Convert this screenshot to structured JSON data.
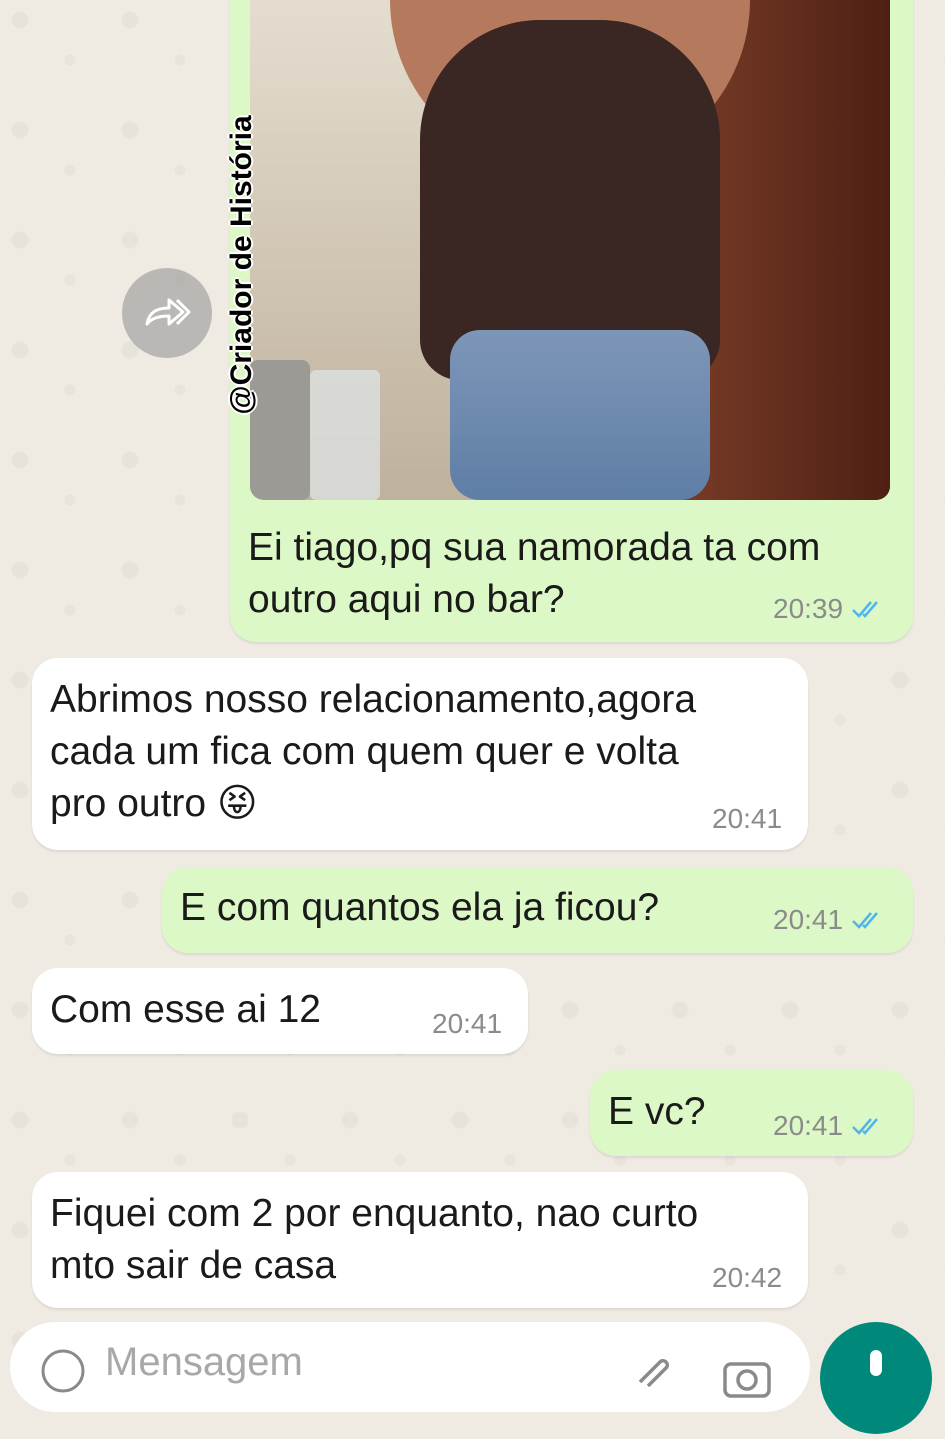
{
  "watermark": "@Criador de História",
  "messages": [
    {
      "direction": "out",
      "text": "Ei tiago,pq sua namorada ta com\noutro aqui no bar?",
      "time": "20:39",
      "read": true,
      "has_image": true
    },
    {
      "direction": "in",
      "text": "Abrimos nosso relacionamento,agora\ncada um fica com quem quer e volta\npro outro 😝",
      "time": "20:41"
    },
    {
      "direction": "out",
      "text": "E com quantos ela ja ficou?",
      "time": "20:41",
      "read": true
    },
    {
      "direction": "in",
      "text": "Com esse ai 12",
      "time": "20:41"
    },
    {
      "direction": "out",
      "text": "E vc?",
      "time": "20:41",
      "read": true
    },
    {
      "direction": "in",
      "text": "Fiquei com 2 por enquanto, nao curto\nmto sair de casa",
      "time": "20:42"
    }
  ],
  "composer": {
    "placeholder": "Mensagem"
  },
  "colors": {
    "outgoing": "#dcf8c6",
    "incoming": "#ffffff",
    "read_ticks": "#4fb6ec",
    "send_button": "#00897b"
  }
}
